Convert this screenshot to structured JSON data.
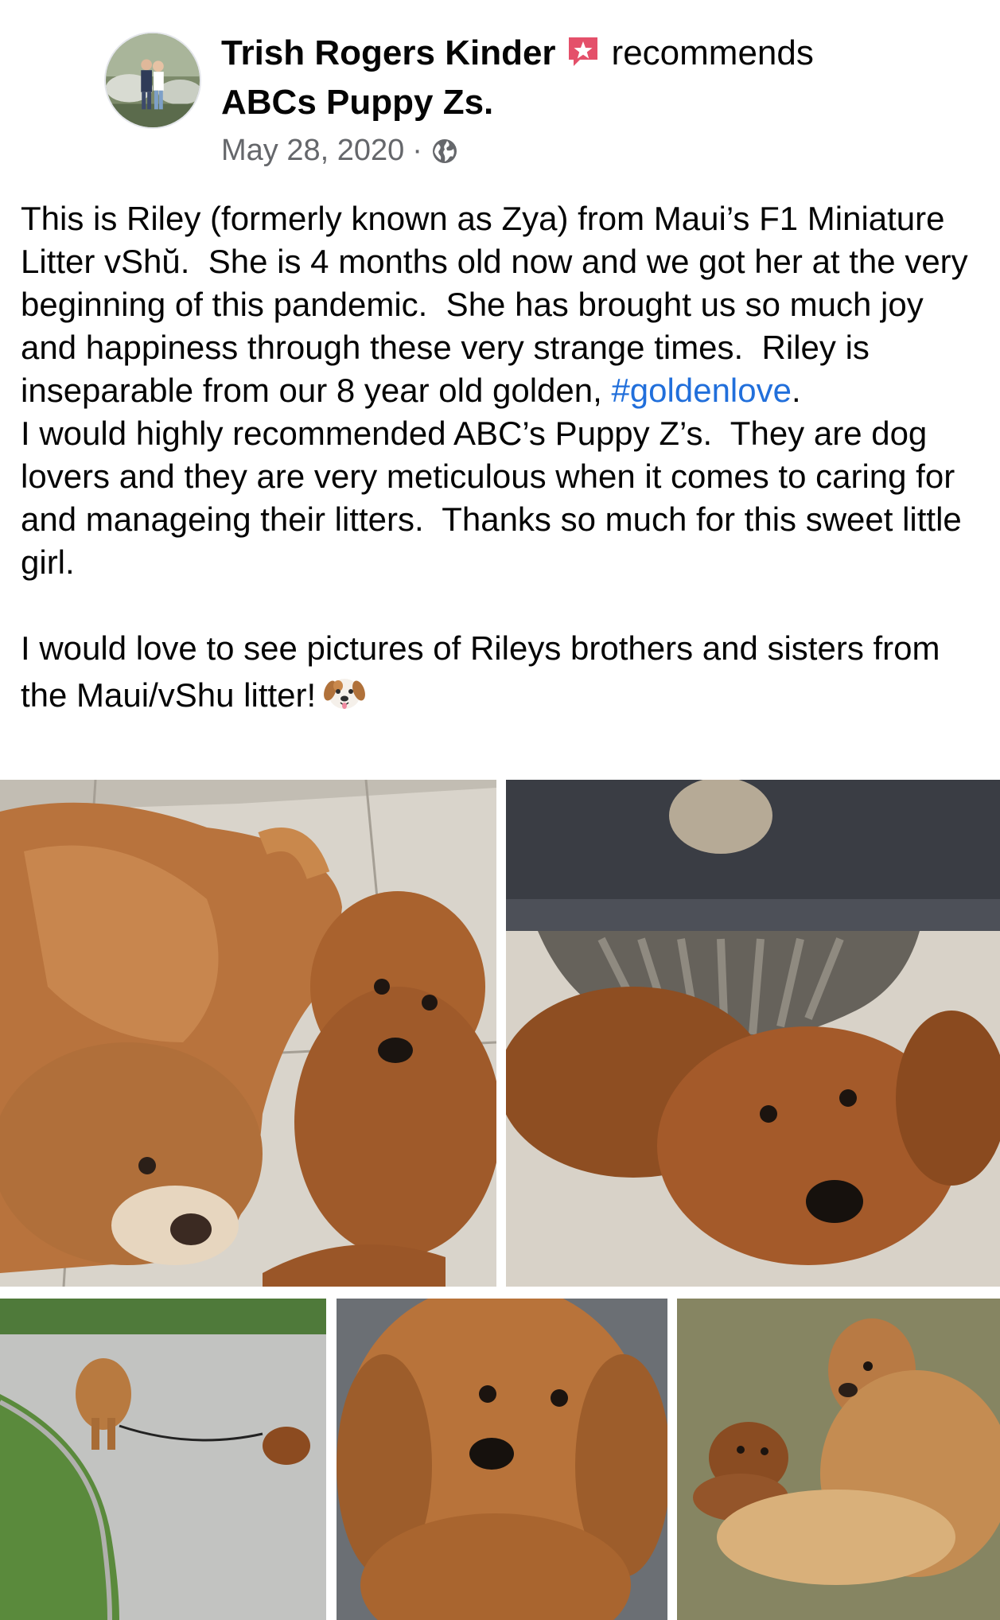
{
  "post": {
    "author": "Trish Rogers Kinder",
    "verb": "recommends",
    "page": "ABCs Puppy Zs.",
    "date": "May 28, 2020",
    "separator": "·",
    "privacy_icon": "globe-icon",
    "rec_icon": "recommend-star-icon"
  },
  "text": {
    "p1": "This is Riley (formerly known as Zya) from Maui’s F1 Miniature Litter vShŭ.  She is 4 months old now and we got her at the very beginning of this pandemic.  She has brought us so much joy and happiness through these very strange times.  Riley is inseparable from our 8 year old golden, ",
    "hashtag": "#goldenlove",
    "p1_end": ".",
    "p2": "I would highly recommended ABC’s Puppy Z’s.  They are dog lovers and they are very meticulous when it comes to caring for and manageing their litters.  Thanks so much for this sweet little girl.",
    "p3": "I would love to see pictures of Rileys brothers and sisters from the Maui/vShu litter!",
    "emoji": "dog-face-emoji"
  },
  "colors": {
    "hashtag": "#216fdb",
    "meta": "#65676b",
    "badge": "#e4506a"
  }
}
